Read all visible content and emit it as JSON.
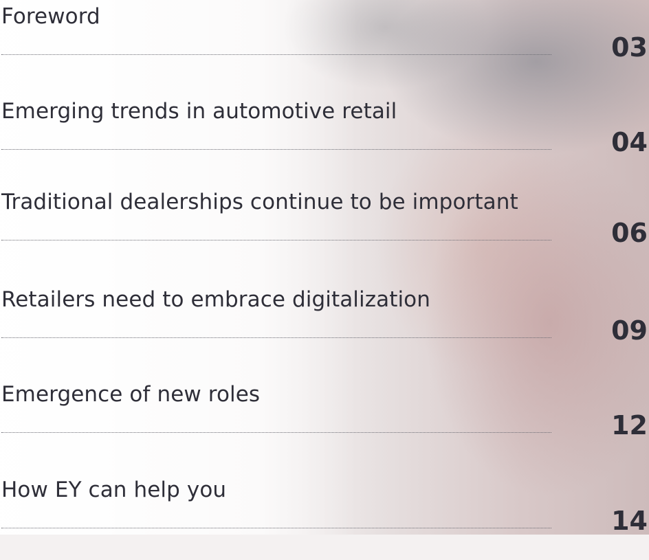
{
  "toc": [
    {
      "title": "Foreword",
      "page": "03"
    },
    {
      "title": "Emerging trends in automotive retail",
      "page": "04"
    },
    {
      "title": "Traditional dealerships continue to be important",
      "page": "06"
    },
    {
      "title": "Retailers need to embrace digitalization",
      "page": "09"
    },
    {
      "title": "Emergence of new roles",
      "page": "12"
    },
    {
      "title": "How EY can help you",
      "page": "14"
    }
  ]
}
